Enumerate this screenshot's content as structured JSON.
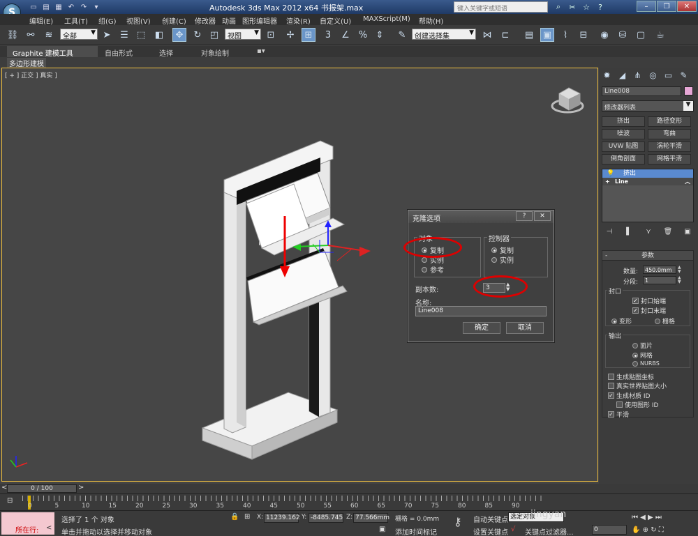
{
  "titlebar": {
    "title": "Autodesk 3ds Max  2012 x64    书报架.max",
    "search_placeholder": "键入关键字或短语",
    "quick_access": [
      "new",
      "open",
      "save",
      "undo",
      "redo"
    ],
    "win_min": "–",
    "win_max": "❐",
    "win_close": "✕"
  },
  "menu": {
    "items": [
      "编辑(E)",
      "工具(T)",
      "组(G)",
      "视图(V)",
      "创建(C)",
      "修改器",
      "动画",
      "图形编辑器",
      "渲染(R)",
      "自定义(U)",
      "MAXScript(M)",
      "帮助(H)"
    ]
  },
  "toolbar": {
    "selection_filter": "全部",
    "reference_coord": "视图",
    "named_selection": "创建选择集"
  },
  "ribbon": {
    "tabs": [
      "Graphite 建模工具",
      "自由形式",
      "选择",
      "对象绘制"
    ],
    "sub_label": "多边形建模"
  },
  "viewport": {
    "label": "[ + ] 正交 ] 真实 ]"
  },
  "command_panel": {
    "object_name": "Line008",
    "object_color": "#e7a7d6",
    "modifier_list": "修改器列表",
    "modifier_buttons": [
      "挤出",
      "路径变形",
      "噪波",
      "弯曲",
      "UVW 贴图",
      "涡轮平滑",
      "倒角剖面",
      "网格平滑"
    ],
    "stack": [
      "挤出",
      "Line"
    ],
    "params": {
      "title": "参数",
      "amount_label": "数量:",
      "amount_value": "450.0mm",
      "segments_label": "分段:",
      "segments_value": "1",
      "capping_label": "封口",
      "cap_start": "封口始端",
      "cap_end": "封口末端",
      "morph": "变形",
      "grid": "栅格",
      "output_label": "输出",
      "patch": "面片",
      "mesh": "网格",
      "nurbs": "NURBS",
      "gen_map_coords": "生成贴图坐标",
      "real_world": "真实世界贴图大小",
      "gen_mat_ids": "生成材质 ID",
      "use_shape_ids": "使用图形 ID",
      "smooth": "平滑"
    }
  },
  "dialog": {
    "title": "克隆选项",
    "help": "?",
    "close": "✕",
    "object_group": "对象",
    "object_options": [
      "复制",
      "实例",
      "参考"
    ],
    "controller_group": "控制器",
    "controller_options": [
      "复制",
      "实例"
    ],
    "copies_label": "副本数:",
    "copies_value": "3",
    "name_label": "名称:",
    "name_value": "Line008",
    "ok": "确定",
    "cancel": "取消"
  },
  "timeline": {
    "frame_readout": "0 / 100",
    "ticks": [
      "0",
      "5",
      "10",
      "15",
      "20",
      "25",
      "30",
      "35",
      "40",
      "45",
      "50",
      "55",
      "60",
      "65",
      "70",
      "75",
      "80",
      "85",
      "90"
    ]
  },
  "status": {
    "running": "所在行:",
    "selection_info": "选择了 1 个 对象",
    "prompt": "单击并拖动以选择并移动对象",
    "x_label": "X:",
    "x_value": "11239.162",
    "y_label": "Y:",
    "y_value": "-8485.745",
    "z_label": "Z:",
    "z_value": "77.566mm",
    "grid": "栅格 = 0.0mm",
    "add_time_tag": "添加时间标记",
    "auto_key": "自动关键点",
    "set_key": "设置关键点",
    "selected_object": "选定对象",
    "key_filters": "关键点过滤器...",
    "frame_value": "0"
  },
  "watermark": "jingyan"
}
